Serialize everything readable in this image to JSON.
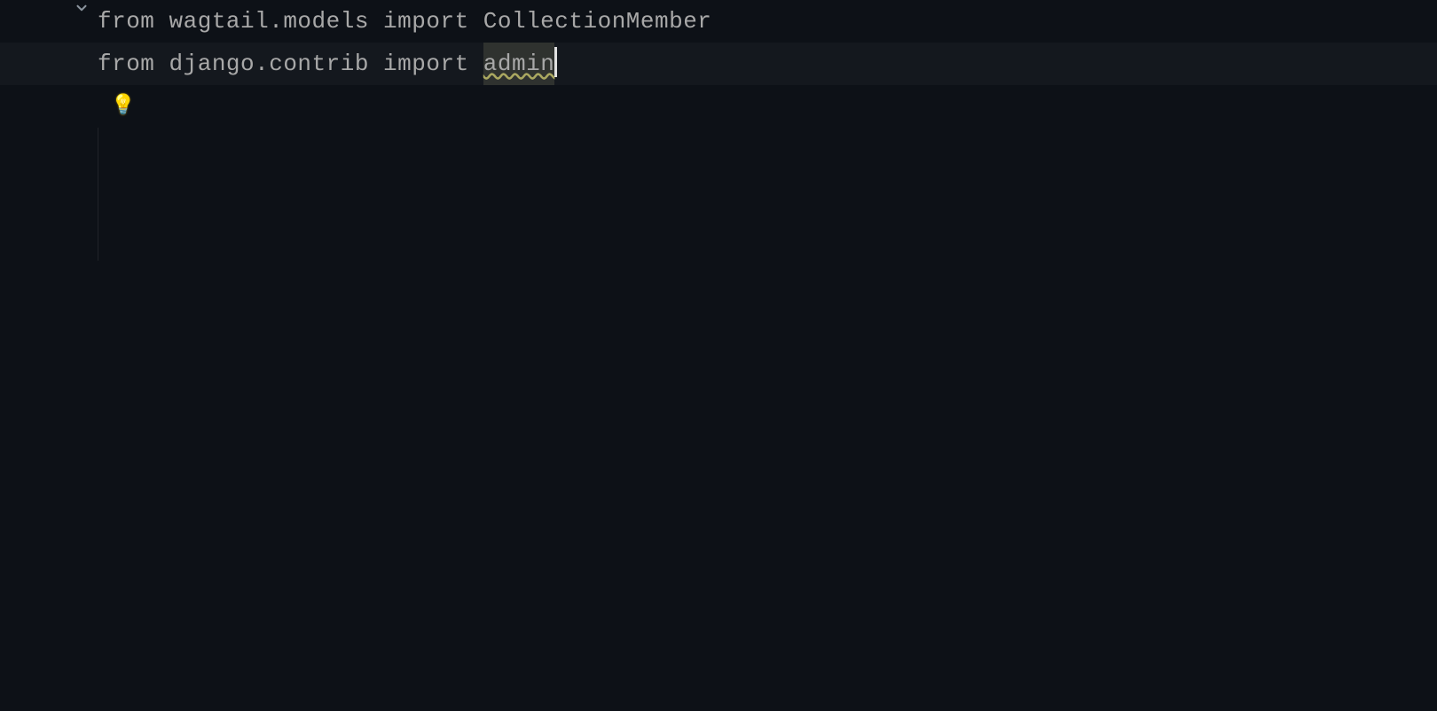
{
  "editor": {
    "lines": [
      {
        "gutter_icon": "chevron-down",
        "segments": [
          {
            "text": "from wagtail.models import CollectionMember",
            "class": ""
          }
        ],
        "active": false,
        "cursor_after": false
      },
      {
        "gutter_icon": null,
        "segments": [
          {
            "text": "from django.contrib import ",
            "class": ""
          },
          {
            "text": "admin",
            "class": "highlight"
          }
        ],
        "active": true,
        "cursor_after": true
      }
    ],
    "lightbulb": {
      "emoji": "💡"
    }
  }
}
